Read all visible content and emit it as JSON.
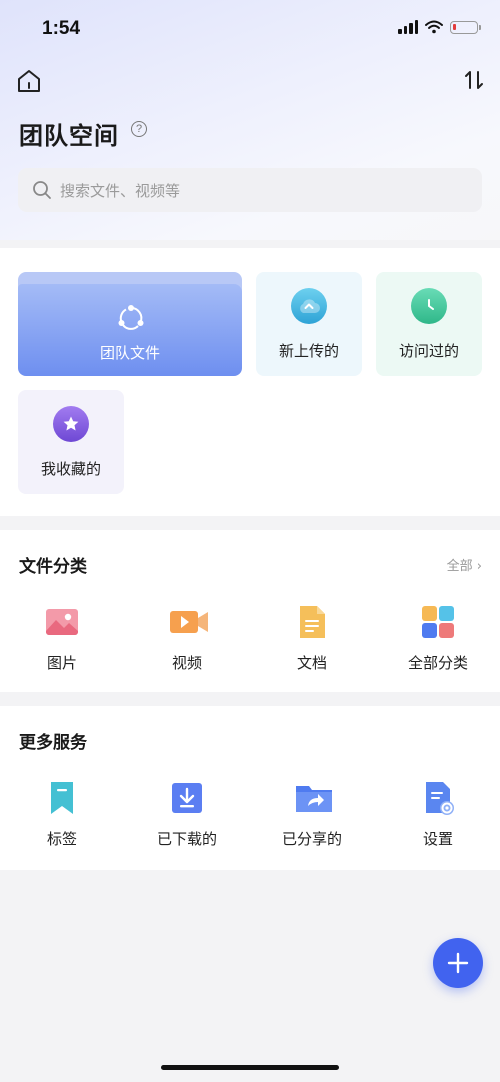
{
  "status_bar": {
    "time": "1:54"
  },
  "header": {
    "title": "团队空间",
    "help_symbol": "?",
    "search_placeholder": "搜索文件、视频等"
  },
  "quick_access": {
    "team_files": "团队文件",
    "tiles": [
      {
        "label": "新上传的",
        "icon": "cloud-upload-icon",
        "color": "#3fb1de"
      },
      {
        "label": "访问过的",
        "icon": "clock-icon",
        "color": "#3fc49b"
      },
      {
        "label": "我收藏的",
        "icon": "star-icon",
        "color": "#7f5bdc"
      }
    ]
  },
  "file_categories": {
    "title": "文件分类",
    "more": "全部 ›",
    "items": [
      {
        "label": "图片",
        "icon": "image-icon"
      },
      {
        "label": "视频",
        "icon": "video-icon"
      },
      {
        "label": "文档",
        "icon": "document-icon"
      },
      {
        "label": "全部分类",
        "icon": "all-categories-icon"
      }
    ]
  },
  "more_services": {
    "title": "更多服务",
    "items": [
      {
        "label": "标签",
        "icon": "bookmark-icon"
      },
      {
        "label": "已下载的",
        "icon": "download-icon"
      },
      {
        "label": "已分享的",
        "icon": "shared-folder-icon"
      },
      {
        "label": "设置",
        "icon": "settings-doc-icon"
      }
    ]
  },
  "fab": {
    "symbol": "+"
  },
  "colors": {
    "accent": "#4163ef",
    "folder": "#7f98f2"
  }
}
